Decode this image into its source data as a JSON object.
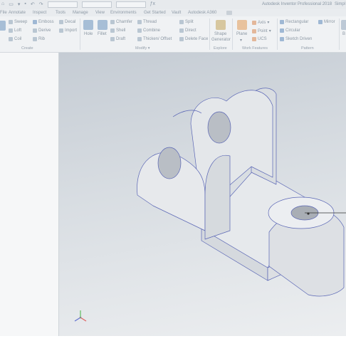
{
  "app": {
    "title": "Autodesk Inventor Professional 2018",
    "document_title": "Simpl"
  },
  "menu_tabs": [
    "File",
    "Annotate",
    "Inspect",
    "Tools",
    "Manage",
    "View",
    "Environments",
    "Get Started",
    "Vault",
    "Autodesk A360"
  ],
  "ribbon": {
    "create": {
      "label": "Create",
      "items": [
        "Sweep",
        "Emboss",
        "Decal",
        "Loft",
        "Derive",
        "Import",
        "Coil",
        "Rib"
      ]
    },
    "modify": {
      "label": "Modify",
      "hole": "Hole",
      "fillet": "Fillet",
      "items": [
        "Chamfer",
        "Shell",
        "Draft",
        "Thread",
        "Combine",
        "Thicken/ Offset",
        "Split",
        "Direct",
        "Delete Face"
      ]
    },
    "explore": {
      "label": "Explore",
      "shape_generator_line1": "Shape",
      "shape_generator_line2": "Generator"
    },
    "work_features": {
      "label": "Work Features",
      "plane": "Plane",
      "axis": "Axis",
      "point": "Point",
      "ucs": "UCS"
    },
    "pattern": {
      "label": "Pattern",
      "rectangular": "Rectangular",
      "circular": "Circular",
      "sketch_driven": "Sketch Driven",
      "mirror": "Mirror"
    },
    "truncated_next": "B"
  },
  "viewport": {
    "model": "bracket-part",
    "colors": {
      "face_top": "#ebedef",
      "face_side": "#dfe2e6",
      "face_dark": "#d2d6db",
      "edge": "#5a66b5"
    }
  },
  "triad": {
    "x_color": "#e06060",
    "y_color": "#5fbf5f",
    "z_color": "#6070d0"
  }
}
